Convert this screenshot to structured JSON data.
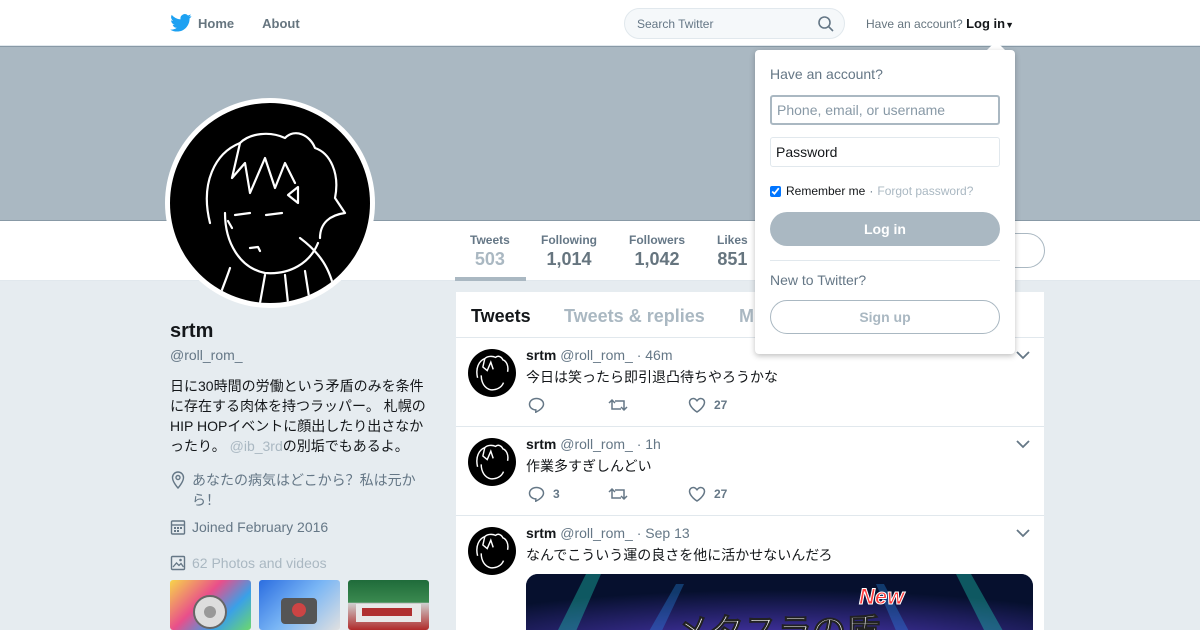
{
  "nav": {
    "home_label": "Home",
    "about_label": "About",
    "search_placeholder": "Search Twitter",
    "account_prompt": "Have an account?",
    "login_label": "Log in"
  },
  "profile": {
    "name": "srtm",
    "handle": "@roll_rom_",
    "bio_text": "日に30時間の労働という矛盾のみを条件に存在する肉体を持つラッパー。 札幌のHIP HOPイベントに顔出したり出さなかったり。",
    "bio_mention": "@ib_3rd",
    "bio_suffix": "の別垢でもあるよ。",
    "location": "あなたの病気はどこから？私は元から！",
    "joined": "Joined February 2016",
    "photos_label": "62 Photos and videos"
  },
  "stats": [
    {
      "label": "Tweets",
      "value": "503"
    },
    {
      "label": "Following",
      "value": "1,014"
    },
    {
      "label": "Followers",
      "value": "1,042"
    },
    {
      "label": "Likes",
      "value": "851"
    }
  ],
  "tabs": [
    {
      "label": "Tweets"
    },
    {
      "label": "Tweets & replies"
    },
    {
      "label": "M"
    }
  ],
  "tweets": [
    {
      "name": "srtm",
      "handle": "@roll_rom_",
      "time": "· 46m",
      "text": "今日は笑ったら即引退凸待ちやろうかな",
      "replies": "",
      "likes": "27"
    },
    {
      "name": "srtm",
      "handle": "@roll_rom_",
      "time": "· 1h",
      "text": "作業多すぎしんどい",
      "replies": "3",
      "likes": "27"
    },
    {
      "name": "srtm",
      "handle": "@roll_rom_",
      "time": "· Sep 13",
      "text": "なんでこういう運の良さを他に活かせないんだろ",
      "media_text": "メタスラの盾",
      "media_badge": "New"
    }
  ],
  "login": {
    "title": "Have an account?",
    "username_placeholder": "Phone, email, or username",
    "password_placeholder": "Password",
    "remember_label": "Remember me",
    "separator": "·",
    "forgot_label": "Forgot password?",
    "login_button": "Log in",
    "new_prompt": "New to Twitter?",
    "signup_button": "Sign up"
  },
  "icons": {
    "logo": "twitter-bird-icon",
    "search": "search-icon",
    "location": "location-pin-icon",
    "calendar": "calendar-icon",
    "photos": "image-icon",
    "reply": "reply-icon",
    "retweet": "retweet-icon",
    "like": "heart-icon",
    "more": "chevron-down-icon"
  },
  "colors": {
    "brand": "#1da1f2",
    "accent": "#aab8c2",
    "muted": "#657786",
    "text": "#14171a"
  }
}
